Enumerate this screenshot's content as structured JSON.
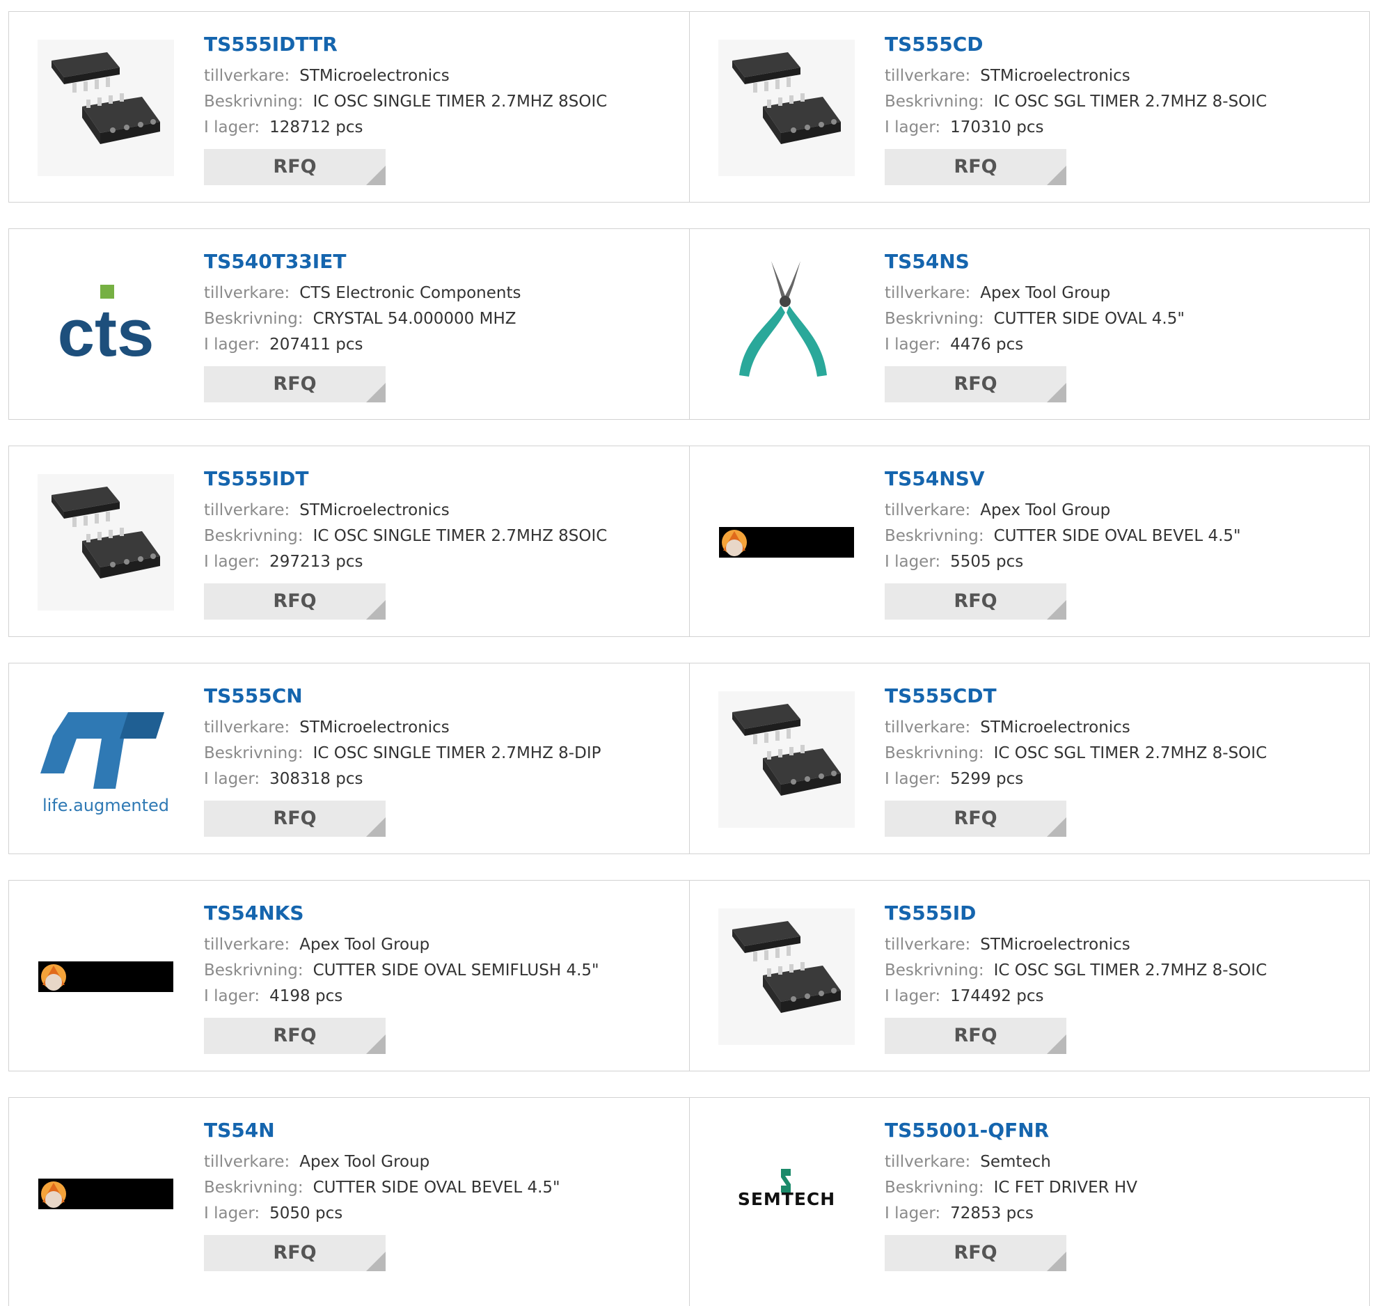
{
  "labels": {
    "manufacturer": "tillverkare:",
    "description": "Beskrivning:",
    "stock": "I lager:",
    "rfq": "RFQ"
  },
  "colors": {
    "link": "#1565ae",
    "label": "#8a8a8a",
    "button_bg": "#e9e9e9"
  },
  "rows": [
    [
      {
        "pn": "TS555IDTTR",
        "mfr": "STMicroelectronics",
        "desc": "IC OSC SINGLE TIMER 2.7MHZ 8SOIC",
        "stock": "128712 pcs",
        "image": "soic-chip"
      },
      {
        "pn": "TS555CD",
        "mfr": "STMicroelectronics",
        "desc": "IC OSC SGL TIMER 2.7MHZ 8-SOIC",
        "stock": "170310 pcs",
        "image": "soic-chip"
      }
    ],
    [
      {
        "pn": "TS540T33IET",
        "mfr": "CTS Electronic Components",
        "desc": "CRYSTAL 54.000000 MHZ",
        "stock": "207411 pcs",
        "image": "cts-logo",
        "logo_text": "cts"
      },
      {
        "pn": "TS54NS",
        "mfr": "Apex Tool Group",
        "desc": "CUTTER SIDE OVAL 4.5\"",
        "stock": "4476 pcs",
        "image": "cutter"
      }
    ],
    [
      {
        "pn": "TS555IDT",
        "mfr": "STMicroelectronics",
        "desc": "IC OSC SINGLE TIMER 2.7MHZ 8SOIC",
        "stock": "297213 pcs",
        "image": "soic-chip"
      },
      {
        "pn": "TS54NSV",
        "mfr": "Apex Tool Group",
        "desc": "CUTTER SIDE OVAL BEVEL 4.5\"",
        "stock": "5505 pcs",
        "image": "apex-banner"
      }
    ],
    [
      {
        "pn": "TS555CN",
        "mfr": "STMicroelectronics",
        "desc": "IC OSC SINGLE TIMER 2.7MHZ 8-DIP",
        "stock": "308318 pcs",
        "image": "st-logo",
        "logo_text": "life.augmented"
      },
      {
        "pn": "TS555CDT",
        "mfr": "STMicroelectronics",
        "desc": "IC OSC SGL TIMER 2.7MHZ 8-SOIC",
        "stock": "5299 pcs",
        "image": "soic-chip"
      }
    ],
    [
      {
        "pn": "TS54NKS",
        "mfr": "Apex Tool Group",
        "desc": "CUTTER SIDE OVAL SEMIFLUSH 4.5\"",
        "stock": "4198 pcs",
        "image": "apex-banner"
      },
      {
        "pn": "TS555ID",
        "mfr": "STMicroelectronics",
        "desc": "IC OSC SGL TIMER 2.7MHZ 8-SOIC",
        "stock": "174492 pcs",
        "image": "soic-chip"
      }
    ],
    [
      {
        "pn": "TS54N",
        "mfr": "Apex Tool Group",
        "desc": "CUTTER SIDE OVAL BEVEL 4.5\"",
        "stock": "5050 pcs",
        "image": "apex-banner"
      },
      {
        "pn": "TS55001-QFNR",
        "mfr": "Semtech",
        "desc": "IC FET DRIVER HV",
        "stock": "72853 pcs",
        "image": "semtech-logo",
        "logo_text": "SEMTECH"
      }
    ]
  ]
}
